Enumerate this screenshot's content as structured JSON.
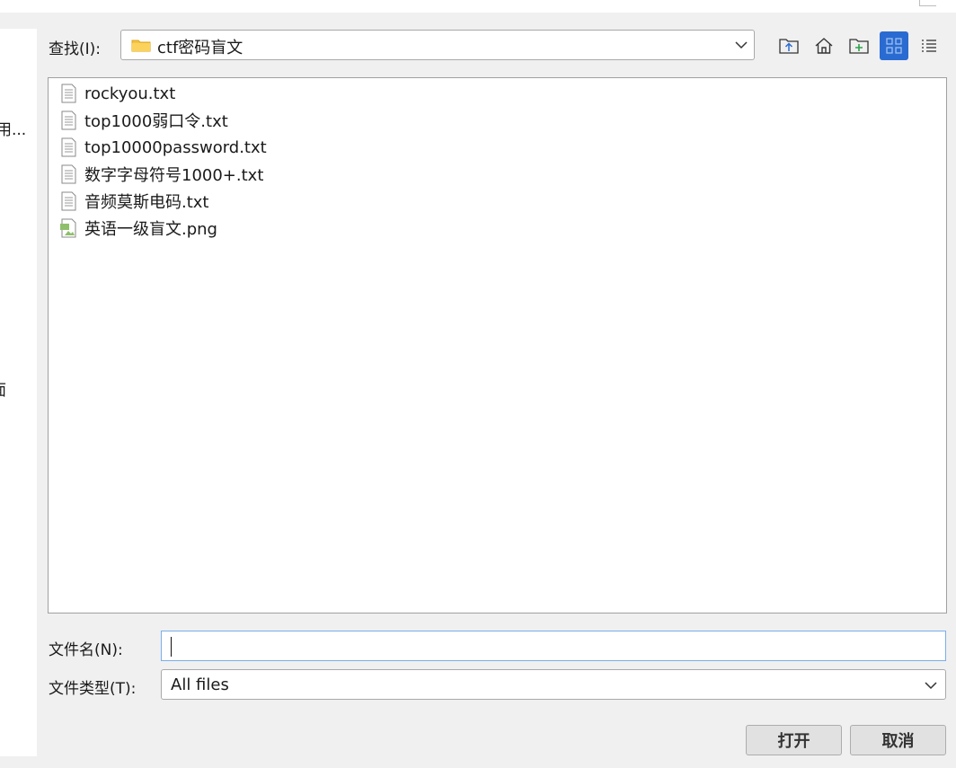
{
  "left_panel": {
    "fragments": [
      "用...",
      "面"
    ]
  },
  "toolbar": {
    "look_in_label": "查找(I):",
    "current_folder": "ctf密码盲文",
    "buttons": [
      {
        "icon": "up-folder-icon"
      },
      {
        "icon": "home-icon"
      },
      {
        "icon": "new-folder-icon"
      },
      {
        "icon": "icon-view-icon",
        "active": true
      },
      {
        "icon": "list-view-icon"
      }
    ]
  },
  "files": [
    {
      "name": "rockyou.txt",
      "icon": "text-file-icon"
    },
    {
      "name": "top1000弱口令.txt",
      "icon": "text-file-icon"
    },
    {
      "name": "top10000password.txt",
      "icon": "text-file-icon"
    },
    {
      "name": "数字字母符号1000+.txt",
      "icon": "text-file-icon"
    },
    {
      "name": "音频莫斯电码.txt",
      "icon": "text-file-icon"
    },
    {
      "name": "英语一级盲文.png",
      "icon": "image-file-icon"
    }
  ],
  "filename_field": {
    "label": "文件名(N):",
    "value": ""
  },
  "filetype_field": {
    "label": "文件类型(T):",
    "value": "All files"
  },
  "buttons": {
    "open": "打开",
    "cancel": "取消"
  },
  "colors": {
    "accent": "#2a6bd1",
    "input_focus": "#7aaee8",
    "folder": "#f5c342"
  }
}
